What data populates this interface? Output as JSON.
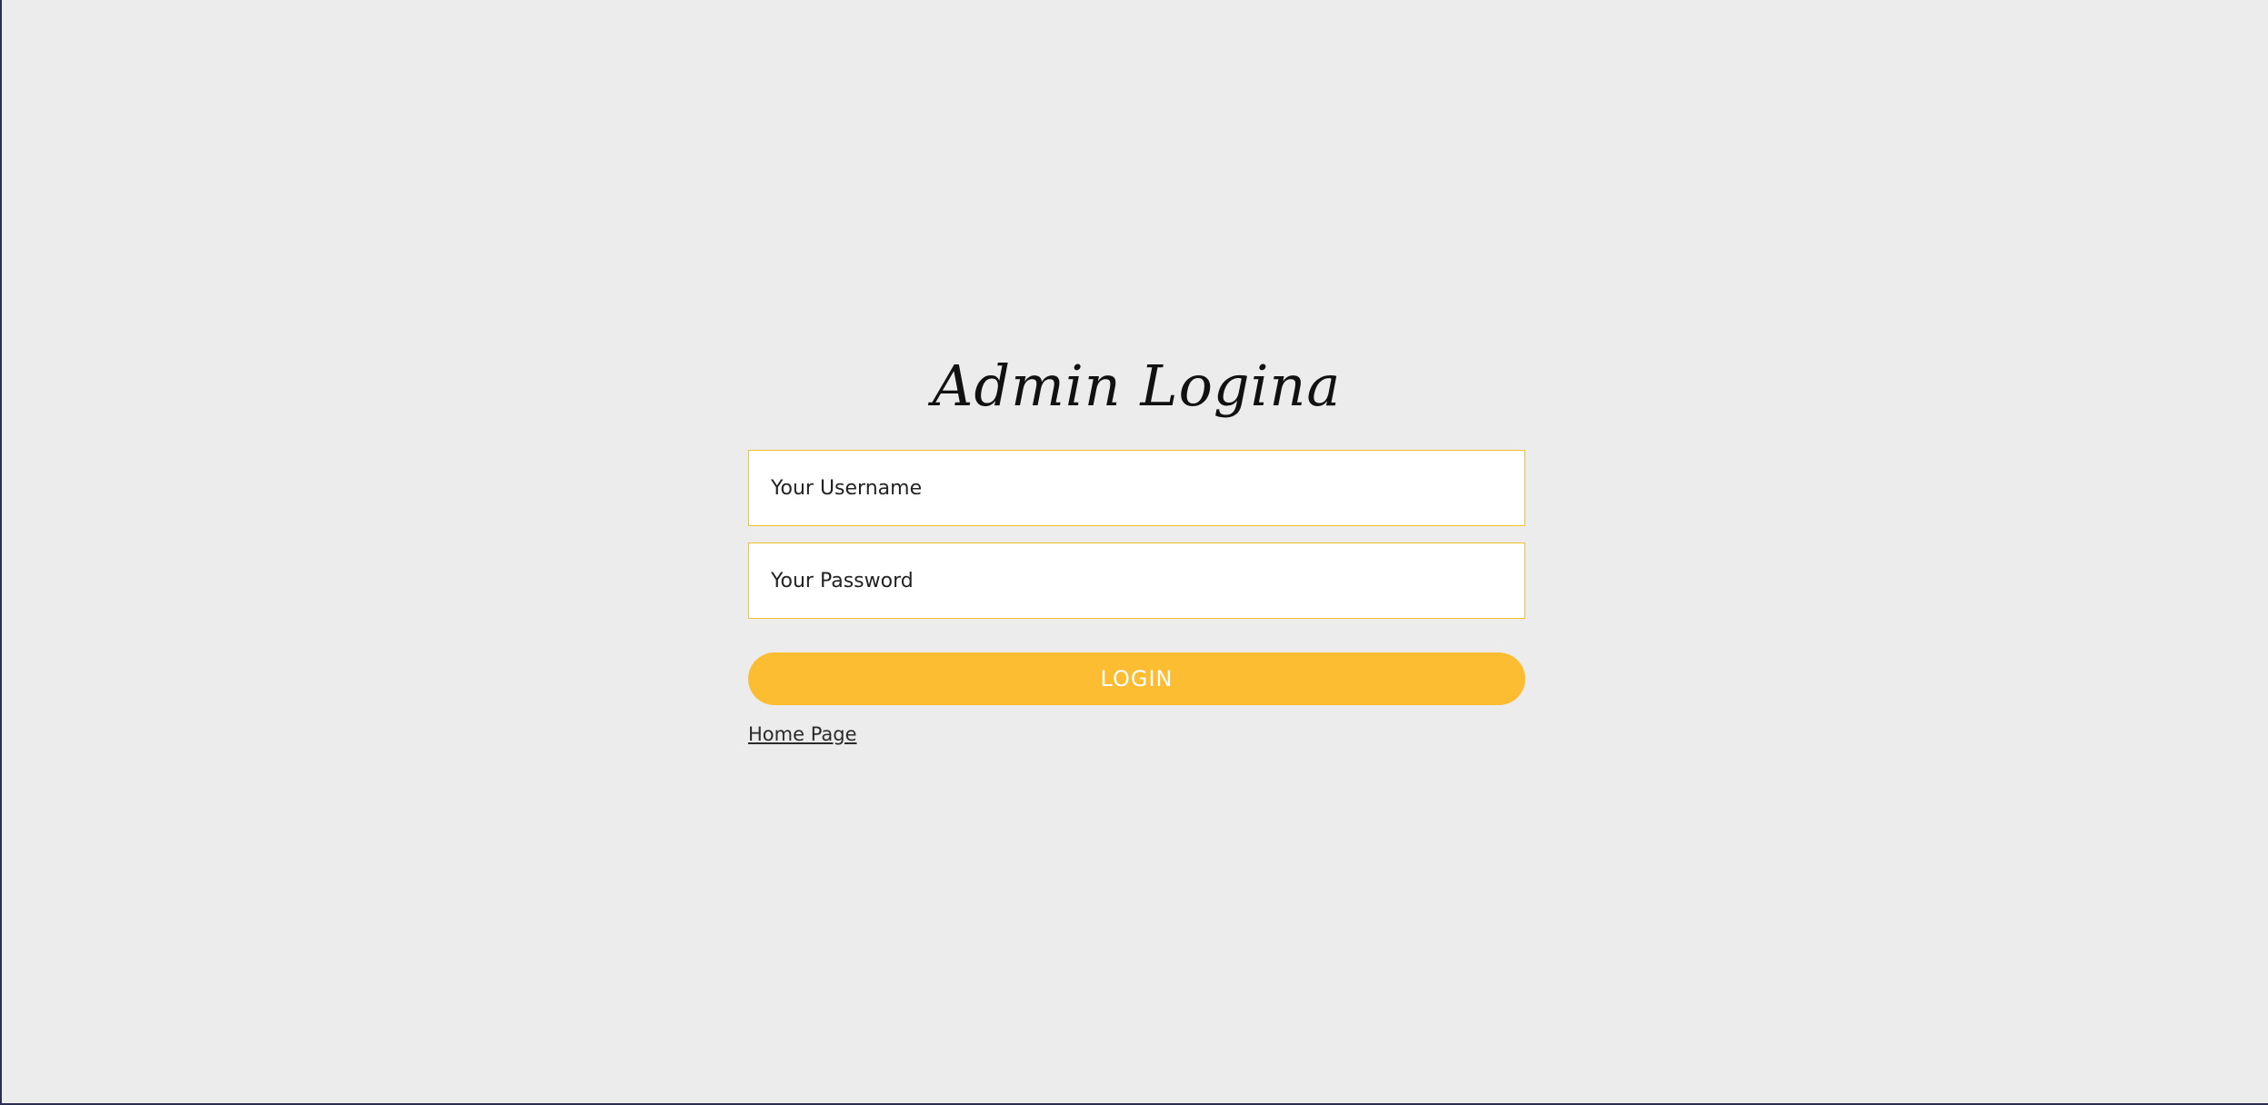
{
  "page": {
    "title": "Admin Logina"
  },
  "form": {
    "username_placeholder": "Your Username",
    "password_placeholder": "Your Password",
    "login_label": "LOGIN",
    "home_link_label": "Home Page"
  },
  "colors": {
    "background": "#ececec",
    "accent": "#fdbd33",
    "field_border": "#f2c131",
    "field_background": "#ffffff",
    "frame_border": "#2a2f52"
  }
}
